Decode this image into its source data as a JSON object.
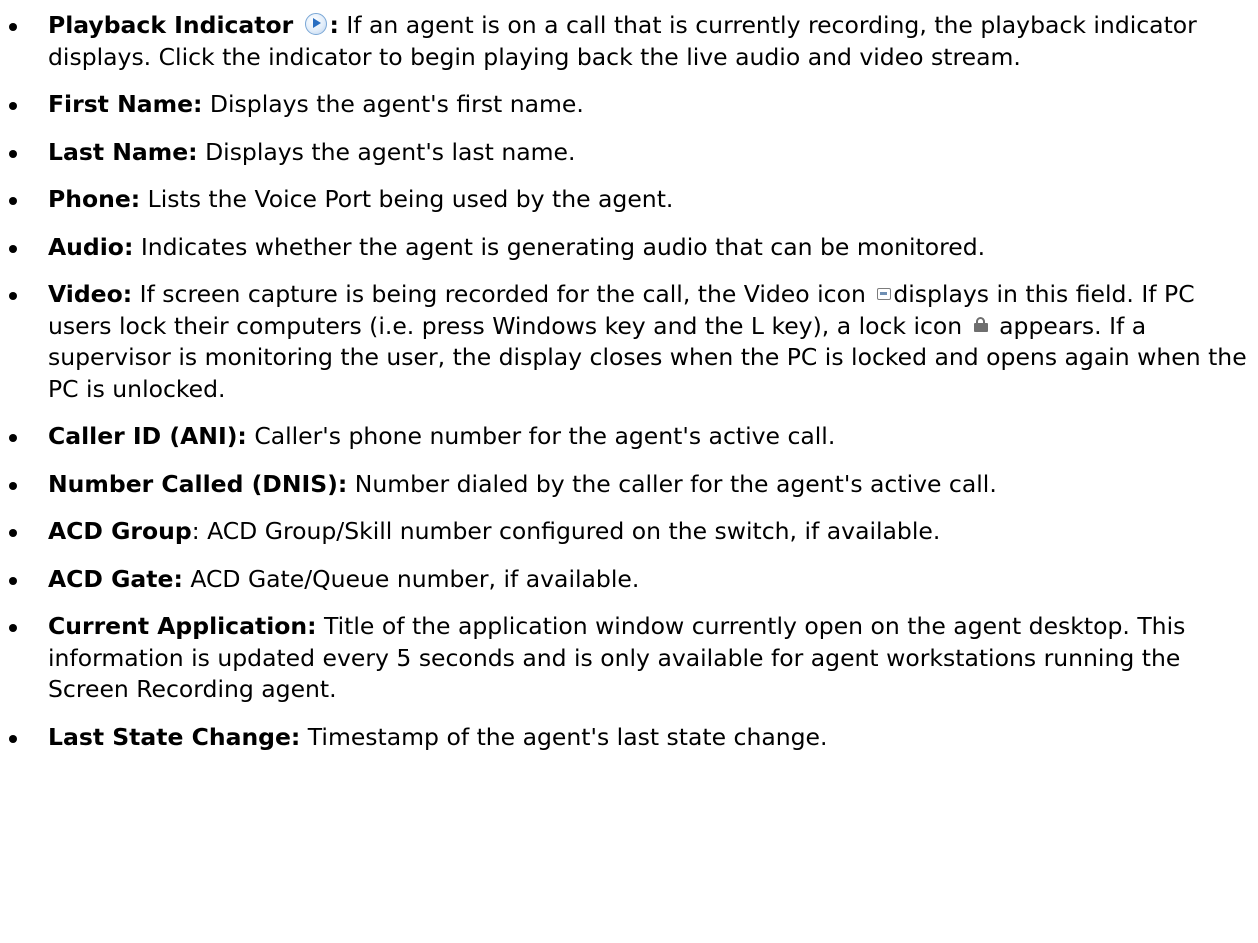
{
  "fields": [
    {
      "term": "Playback Indicator ",
      "after_icon": ":",
      "desc": " If an agent is on a call that is currently recording, the playback indicator displays. Click the indicator to begin playing back the live audio and video stream."
    },
    {
      "term": "First Name:",
      "desc": " Displays the agent's first name."
    },
    {
      "term": "Last Name:",
      "desc": " Displays the agent's last name."
    },
    {
      "term": "Phone:",
      "desc": " Lists the Voice Port being used by the agent."
    },
    {
      "term": "Audio:",
      "desc": " Indicates whether the agent is generating audio that can be monitored."
    },
    {
      "term": "Video:",
      "desc_1": " If screen capture is being recorded for the call, the Video icon ",
      "desc_2": "displays in this field. If PC users lock their computers (i.e. press Windows key and the L key), a lock icon ",
      "desc_3": " appears. If a supervisor is monitoring the user, the display closes when the PC is locked and opens again when the PC is unlocked."
    },
    {
      "term": "Caller ID (ANI):",
      "desc": " Caller's phone number for the agent's active call."
    },
    {
      "term": "Number Called (DNIS):",
      "desc": " Number dialed by the caller for the agent's active call."
    },
    {
      "term": "ACD Group",
      "desc": ": ACD Group/Skill number configured on the switch, if available."
    },
    {
      "term": "ACD Gate:",
      "desc": " ACD Gate/Queue number, if available."
    },
    {
      "term": "Current Application:",
      "desc": " Title of the application window currently open on the agent desktop. This information is updated every 5 seconds and is only available for agent workstations running the Screen Recording agent."
    },
    {
      "term": "Last State Change:",
      "desc": " Timestamp of the agent's last state change."
    }
  ],
  "icons": {
    "playback": "play-circle-icon",
    "video": "video-icon",
    "lock": "lock-icon"
  },
  "colors": {
    "text": "#000000",
    "background": "#ffffff",
    "play_icon": "#2a6fc1"
  }
}
